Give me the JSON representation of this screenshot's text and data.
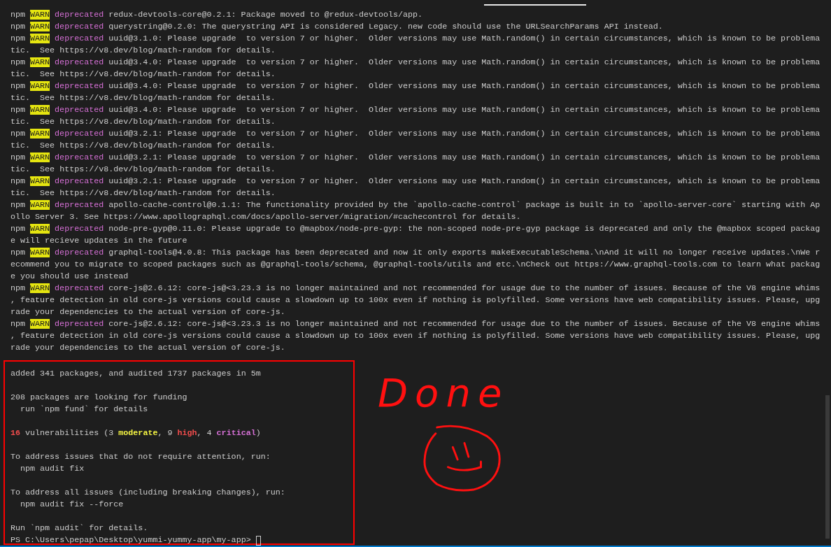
{
  "log": [
    {
      "prefix": "npm",
      "level": "WARN",
      "tag": "deprecated",
      "lines": [
        "redux-devtools-core@0.2.1: Package moved to @redux-devtools/app."
      ]
    },
    {
      "prefix": "npm",
      "level": "WARN",
      "tag": "deprecated",
      "lines": [
        "querystring@0.2.0: The querystring API is considered Legacy. new code should use the URLSearchParams API instead."
      ]
    },
    {
      "prefix": "npm",
      "level": "WARN",
      "tag": "deprecated",
      "lines": [
        "uuid@3.1.0: Please upgrade  to version 7 or higher.  Older versions may use Math.random() in certain circumstances, which is known to be problema",
        "tic.  See https://v8.dev/blog/math-random for details."
      ]
    },
    {
      "prefix": "npm",
      "level": "WARN",
      "tag": "deprecated",
      "lines": [
        "uuid@3.4.0: Please upgrade  to version 7 or higher.  Older versions may use Math.random() in certain circumstances, which is known to be problema",
        "tic.  See https://v8.dev/blog/math-random for details."
      ]
    },
    {
      "prefix": "npm",
      "level": "WARN",
      "tag": "deprecated",
      "lines": [
        "uuid@3.4.0: Please upgrade  to version 7 or higher.  Older versions may use Math.random() in certain circumstances, which is known to be problema",
        "tic.  See https://v8.dev/blog/math-random for details."
      ]
    },
    {
      "prefix": "npm",
      "level": "WARN",
      "tag": "deprecated",
      "lines": [
        "uuid@3.4.0: Please upgrade  to version 7 or higher.  Older versions may use Math.random() in certain circumstances, which is known to be problema",
        "tic.  See https://v8.dev/blog/math-random for details."
      ]
    },
    {
      "prefix": "npm",
      "level": "WARN",
      "tag": "deprecated",
      "lines": [
        "uuid@3.2.1: Please upgrade  to version 7 or higher.  Older versions may use Math.random() in certain circumstances, which is known to be problema",
        "tic.  See https://v8.dev/blog/math-random for details."
      ]
    },
    {
      "prefix": "npm",
      "level": "WARN",
      "tag": "deprecated",
      "lines": [
        "uuid@3.2.1: Please upgrade  to version 7 or higher.  Older versions may use Math.random() in certain circumstances, which is known to be problema",
        "tic.  See https://v8.dev/blog/math-random for details."
      ]
    },
    {
      "prefix": "npm",
      "level": "WARN",
      "tag": "deprecated",
      "lines": [
        "uuid@3.2.1: Please upgrade  to version 7 or higher.  Older versions may use Math.random() in certain circumstances, which is known to be problema",
        "tic.  See https://v8.dev/blog/math-random for details."
      ]
    },
    {
      "prefix": "npm",
      "level": "WARN",
      "tag": "deprecated",
      "lines": [
        "apollo-cache-control@0.1.1: The functionality provided by the `apollo-cache-control` package is built in to `apollo-server-core` starting with Ap",
        "ollo Server 3. See https://www.apollographql.com/docs/apollo-server/migration/#cachecontrol for details."
      ]
    },
    {
      "prefix": "npm",
      "level": "WARN",
      "tag": "deprecated",
      "lines": [
        "node-pre-gyp@0.11.0: Please upgrade to @mapbox/node-pre-gyp: the non-scoped node-pre-gyp package is deprecated and only the @mapbox scoped packag",
        "e will recieve updates in the future"
      ]
    },
    {
      "prefix": "npm",
      "level": "WARN",
      "tag": "deprecated",
      "lines": [
        "graphql-tools@4.0.8: This package has been deprecated and now it only exports makeExecutableSchema.\\nAnd it will no longer receive updates.\\nWe r",
        "ecommend you to migrate to scoped packages such as @graphql-tools/schema, @graphql-tools/utils and etc.\\nCheck out https://www.graphql-tools.com to learn what packag",
        "e you should use instead"
      ]
    },
    {
      "prefix": "npm",
      "level": "WARN",
      "tag": "deprecated",
      "lines": [
        "core-js@2.6.12: core-js@<3.23.3 is no longer maintained and not recommended for usage due to the number of issues. Because of the V8 engine whims",
        ", feature detection in old core-js versions could cause a slowdown up to 100x even if nothing is polyfilled. Some versions have web compatibility issues. Please, upg",
        "rade your dependencies to the actual version of core-js."
      ]
    },
    {
      "prefix": "npm",
      "level": "WARN",
      "tag": "deprecated",
      "lines": [
        "core-js@2.6.12: core-js@<3.23.3 is no longer maintained and not recommended for usage due to the number of issues. Because of the V8 engine whims",
        ", feature detection in old core-js versions could cause a slowdown up to 100x even if nothing is polyfilled. Some versions have web compatibility issues. Please, upg",
        "rade your dependencies to the actual version of core-js."
      ]
    }
  ],
  "summary": {
    "paragraphs": [
      [
        {
          "segments": [
            {
              "text": "added 341 packages, and audited 1737 packages in 5m"
            }
          ]
        }
      ],
      [
        {
          "segments": [
            {
              "text": "208 packages are looking for funding"
            }
          ]
        },
        {
          "segments": [
            {
              "text": "  run `npm fund` for details"
            }
          ]
        }
      ],
      [
        {
          "segments": [
            {
              "text": "16",
              "color": "#f14c4c"
            },
            {
              "text": " vulnerabilities (3 "
            },
            {
              "text": "moderate",
              "color": "#f5f543"
            },
            {
              "text": ", 9 "
            },
            {
              "text": "high",
              "color": "#f14c4c"
            },
            {
              "text": ", 4 "
            },
            {
              "text": "critical",
              "color": "#d670d6"
            },
            {
              "text": ")"
            }
          ]
        }
      ],
      [
        {
          "segments": [
            {
              "text": "To address issues that do not require attention, run:"
            }
          ]
        },
        {
          "segments": [
            {
              "text": "  npm audit fix"
            }
          ]
        }
      ],
      [
        {
          "segments": [
            {
              "text": "To address all issues (including breaking changes), run:"
            }
          ]
        },
        {
          "segments": [
            {
              "text": "  npm audit fix --force"
            }
          ]
        }
      ],
      [
        {
          "segments": [
            {
              "text": "Run `npm audit` for details."
            }
          ]
        }
      ]
    ],
    "prompt": "PS C:\\Users\\pepap\\Desktop\\yummi-yummy-app\\my-app>"
  },
  "annotation": {
    "text": "Done"
  }
}
